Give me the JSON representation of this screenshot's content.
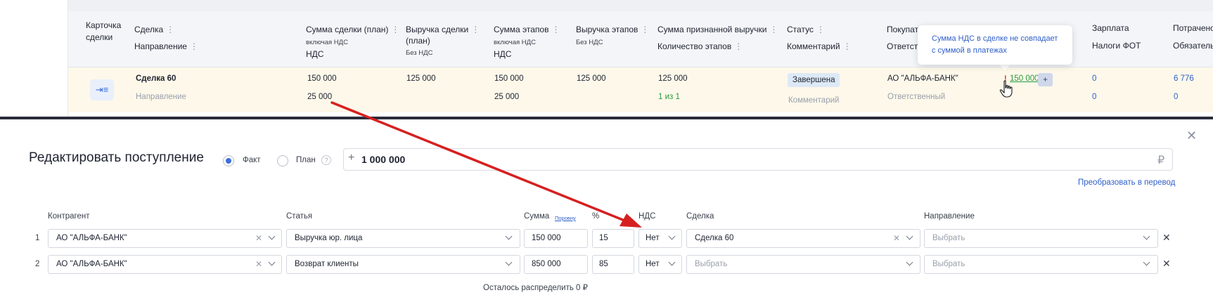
{
  "table": {
    "headers": {
      "card": "Карточка\nсделки",
      "card_l1": "Карточка",
      "card_l2": "сделки",
      "deal": "Сделка",
      "direction": "Направление",
      "deal_sum_plan": "Сумма сделки (план)",
      "incl_vat": "включая НДС",
      "vat": "НДС",
      "deal_revenue_plan_l1": "Выручка сделки",
      "deal_revenue_plan_l2": "(план)",
      "no_vat": "Без НДС",
      "stages_sum": "Сумма этапов",
      "stages_incl_vat": "включая НДС",
      "stages_vat": "НДС",
      "stages_revenue": "Выручка этапов",
      "stages_no_vat": "Без НДС",
      "recognized_revenue": "Сумма признанной выручки",
      "stages_count": "Количество этапов",
      "status": "Статус",
      "comment": "Комментарий",
      "buyer": "Покупат",
      "responsible": "Ответств",
      "salary": "Зарплата",
      "payroll_taxes": "Налоги ФОТ",
      "spent": "Потрачено",
      "obligations": "Обязатель"
    },
    "row": {
      "deal_name": "Сделка 60",
      "direction_placeholder": "Направление",
      "deal_sum": "150 000",
      "deal_vat": "25 000",
      "deal_revenue": "125 000",
      "stages_sum": "150 000",
      "stages_vat": "25 000",
      "stages_revenue": "125 000",
      "recognized": "125 000",
      "stages_count": "1 из 1",
      "status": "Завершена",
      "comment_placeholder": "Комментарий",
      "buyer": "АО \"АЛЬФА-БАНК\"",
      "responsible_placeholder": "Ответственный",
      "vat_warning_mark": "!",
      "vat_value": "150 000",
      "plus": "+",
      "salary": "0",
      "payroll_taxes": "0",
      "spent": "6 776",
      "obligations": "0"
    },
    "tooltip": "Сумма НДС в сделке не совпадает с суммой в платежах"
  },
  "modal": {
    "title": "Редактировать поступление",
    "radio_fact": "Факт",
    "radio_plan": "План",
    "help": "?",
    "amount_plus": "+",
    "amount": "1 000 000",
    "currency": "₽",
    "convert_link": "Преобразовать в перевод",
    "columns": {
      "counterparty": "Контрагент",
      "article": "Статья",
      "sum": "Сумма",
      "evenly": "Поровну",
      "percent": "%",
      "vat": "НДС",
      "deal": "Сделка",
      "direction": "Направление"
    },
    "rows": [
      {
        "num": "1",
        "counterparty": "АО \"АЛЬФА-БАНК\"",
        "article": "Выручка юр. лица",
        "sum": "150 000",
        "percent": "15",
        "vat": "Нет",
        "deal": "Сделка 60",
        "direction": "Выбрать"
      },
      {
        "num": "2",
        "counterparty": "АО \"АЛЬФА-БАНК\"",
        "article": "Возврат клиенты",
        "sum": "850 000",
        "percent": "85",
        "vat": "Нет",
        "deal": "Выбрать",
        "direction": "Выбрать"
      }
    ],
    "remaining": "Осталось распределить 0 ₽"
  },
  "colors": {
    "accent_blue": "#2f5fc9",
    "green": "#2a9a3a",
    "arrow_red": "#d62020",
    "row_highlight": "#fdf8ea"
  }
}
